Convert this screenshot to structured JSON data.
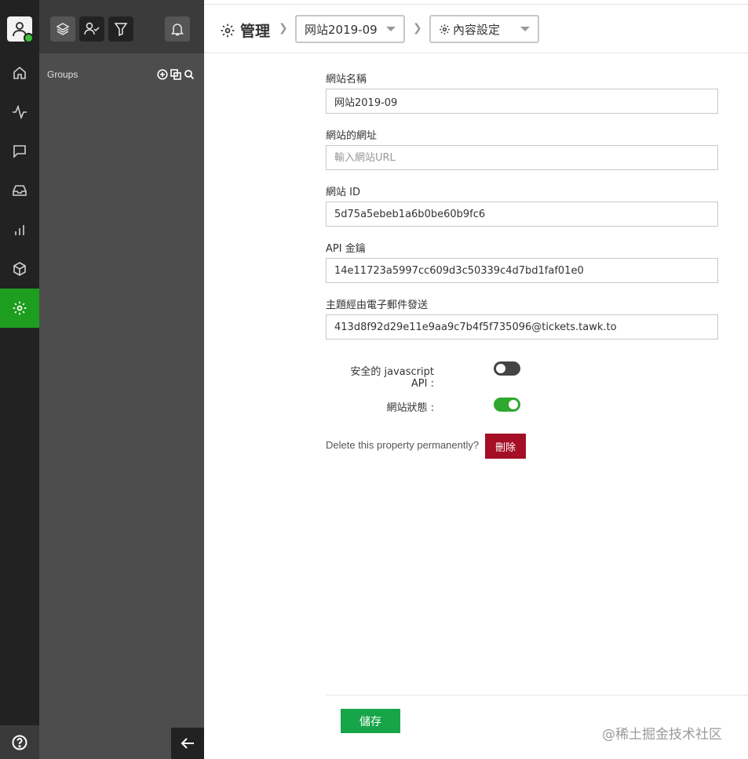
{
  "panel": {
    "groups_label": "Groups"
  },
  "header": {
    "title": "管理",
    "property_select": "网站2019-09",
    "section_select": "內容設定"
  },
  "form": {
    "site_name": {
      "label": "網站名稱",
      "value": "网站2019-09"
    },
    "site_url": {
      "label": "網站的網址",
      "placeholder": "輸入網站URL",
      "value": ""
    },
    "site_id": {
      "label": "網站 ID",
      "value": "5d75a5ebeb1a6b0be60b9fc6"
    },
    "api_key": {
      "label": "API 金鑰",
      "value": "14e11723a5997cc609d3c50339c4d7bd1faf01e0"
    },
    "email_topic": {
      "label": "主題經由電子郵件發送",
      "value": "413d8f92d29e11e9aa9c7b4f5f735096@tickets.tawk.to"
    },
    "secure_js_api": {
      "label": "安全的 javascript API :",
      "enabled": false
    },
    "site_status": {
      "label": "網站狀態 :",
      "enabled": true
    },
    "delete_prompt": "Delete this property permanently?",
    "delete_label": "刪除"
  },
  "footer": {
    "save_label": "儲存",
    "watermark": "@稀土掘金技术社区"
  },
  "colors": {
    "active_nav": "#1e9e1e",
    "toggle_on": "#2ea82e",
    "toggle_off": "#444444",
    "delete": "#a50f26",
    "save": "#17a54a"
  }
}
